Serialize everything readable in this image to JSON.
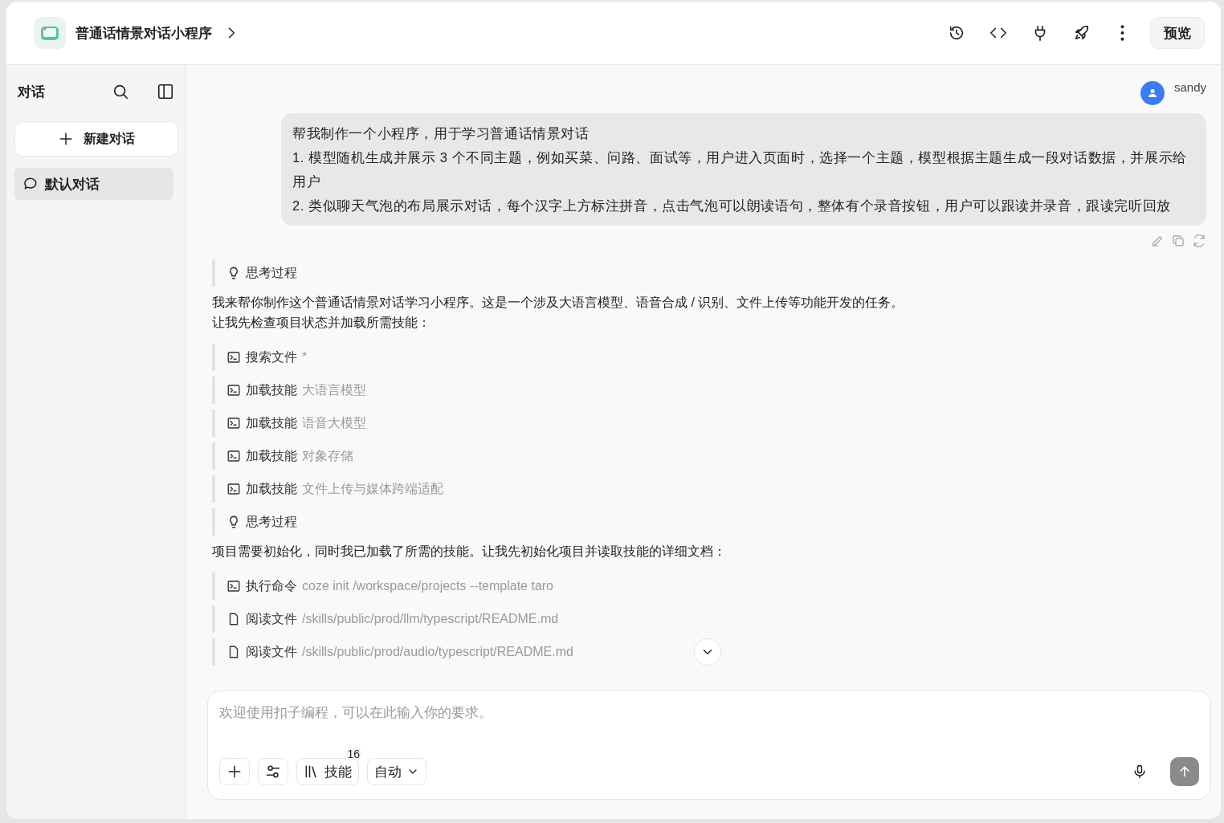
{
  "app": {
    "title": "普通话情景对话小程序"
  },
  "toolbar": {
    "preview_button": "预览"
  },
  "sidebar": {
    "title": "对话",
    "new_chat_button": "新建对话",
    "conversations": [
      {
        "label": "默认对话",
        "selected": true
      }
    ]
  },
  "user": {
    "name": "sandy"
  },
  "user_message": {
    "lines": [
      "帮我制作一个小程序，用于学习普通话情景对话",
      "1. 模型随机生成并展示 3 个不同主题，例如买菜、问路、面试等，用户进入页面时，选择一个主题，模型根据主题生成一段对话数据，并展示给用户",
      "2. 类似聊天气泡的布局展示对话，每个汉字上方标注拼音，点击气泡可以朗读语句，整体有个录音按钮，用户可以跟读并录音，跟读完听回放"
    ]
  },
  "response": [
    {
      "kind": "thinking",
      "label": "思考过程"
    },
    {
      "kind": "text",
      "lines": [
        "我来帮你制作这个普通话情景对话学习小程序。这是一个涉及大语言模型、语音合成 / 识别、文件上传等功能开发的任务。",
        "让我先检查项目状态并加载所需技能："
      ]
    },
    {
      "kind": "command",
      "action": "搜索文件",
      "detail": "*"
    },
    {
      "kind": "command",
      "action": "加载技能",
      "detail": "大语言模型"
    },
    {
      "kind": "command",
      "action": "加载技能",
      "detail": "语音大模型"
    },
    {
      "kind": "command",
      "action": "加载技能",
      "detail": "对象存储"
    },
    {
      "kind": "command",
      "action": "加载技能",
      "detail": "文件上传与媒体跨端适配"
    },
    {
      "kind": "thinking",
      "label": "思考过程"
    },
    {
      "kind": "text",
      "lines": [
        "项目需要初始化，同时我已加载了所需的技能。让我先初始化项目并读取技能的详细文档："
      ]
    },
    {
      "kind": "command",
      "action": "执行命令",
      "detail": "coze init /workspace/projects --template taro"
    },
    {
      "kind": "file",
      "action": "阅读文件",
      "detail": "/skills/public/prod/llm/typescript/README.md"
    },
    {
      "kind": "file",
      "action": "阅读文件",
      "detail": "/skills/public/prod/audio/typescript/README.md"
    }
  ],
  "composer": {
    "placeholder": "欢迎使用扣子编程，可以在此输入你的要求。",
    "skills_button": "技能",
    "skills_count": "16",
    "mode_select": "自动"
  }
}
